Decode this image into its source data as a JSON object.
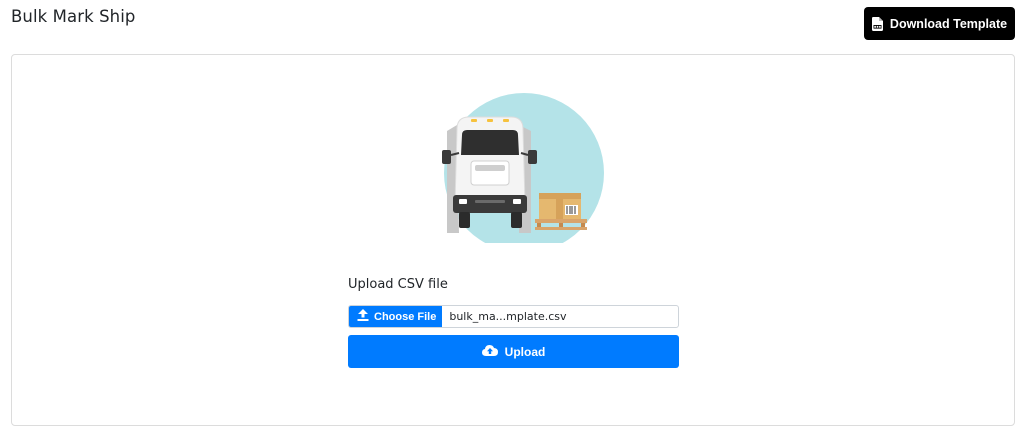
{
  "page": {
    "title": "Bulk Mark Ship"
  },
  "header": {
    "download_template_label": "Download Template",
    "download_icon": "csv-file-icon"
  },
  "upload": {
    "label": "Upload CSV file",
    "choose_file_label": "Choose File",
    "choose_file_icon": "upload-icon",
    "file_name": "bulk_ma...mplate.csv",
    "upload_button_label": "Upload",
    "upload_button_icon": "cloud-upload-icon"
  },
  "illustration": {
    "icon": "delivery-truck-illustration"
  },
  "colors": {
    "primary": "#007bff",
    "dark_button": "#000000",
    "illustration_circle": "#b4e3e8"
  }
}
